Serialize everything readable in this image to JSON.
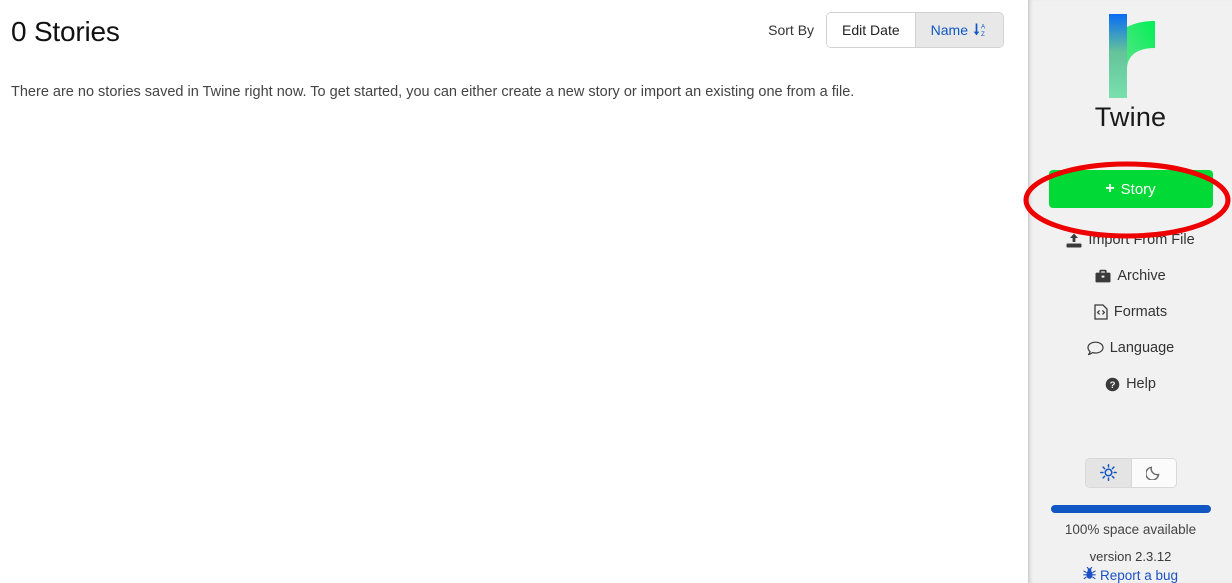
{
  "main": {
    "page_title": "0 Stories",
    "sort": {
      "label": "Sort By",
      "options": [
        {
          "label": "Edit Date",
          "name": "edit-date",
          "active": false
        },
        {
          "label": "Name",
          "name": "name",
          "active": true,
          "icon": "sort-alpha-down-icon"
        }
      ]
    },
    "empty_message": "There are no stories saved in Twine right now. To get started, you can either create a new story or import an existing one from a file."
  },
  "sidebar": {
    "brand": "Twine",
    "logo_icon": "twine-logo-icon",
    "primary_action": {
      "label": "Story",
      "plus": "+",
      "icon": "plus-icon",
      "color": "#00d936"
    },
    "menu": [
      {
        "label": "Import From File",
        "icon": "upload-icon",
        "name": "import-from-file"
      },
      {
        "label": "Archive",
        "icon": "briefcase-icon",
        "name": "archive"
      },
      {
        "label": "Formats",
        "icon": "file-code-icon",
        "name": "formats"
      },
      {
        "label": "Language",
        "icon": "comment-icon",
        "name": "language"
      },
      {
        "label": "Help",
        "icon": "question-circle-icon",
        "name": "help"
      }
    ],
    "theme": {
      "light": {
        "icon": "sun-icon",
        "active": true
      },
      "dark": {
        "icon": "moon-icon",
        "active": false
      }
    },
    "storage": {
      "percent": 100,
      "text": "100% space available",
      "bar_color": "#1157c4"
    },
    "version": "version 2.3.12",
    "bug_link": {
      "label": "Report a bug",
      "icon": "bug-icon",
      "color": "#1b51c4"
    }
  },
  "annotation": {
    "shape": "ellipse",
    "color": "#ee0000",
    "target": "story-button"
  }
}
